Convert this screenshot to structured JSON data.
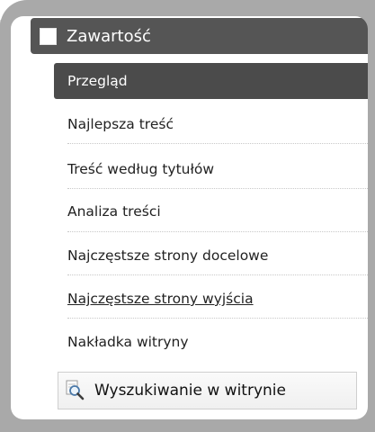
{
  "section": {
    "title": "Zawartość",
    "checkbox_icon": "checkbox-icon"
  },
  "menu": {
    "items": [
      {
        "label": "Przegląd",
        "active": true
      },
      {
        "label": "Najlepsza treść"
      },
      {
        "label": "Treść według tytułów"
      },
      {
        "label": "Analiza treści"
      },
      {
        "label": "Najczęstsze strony docelowe"
      },
      {
        "label": "Najczęstsze strony wyjścia",
        "underlined": true
      },
      {
        "label": "Nakładka witryny"
      }
    ]
  },
  "search": {
    "label": "Wyszukiwanie w witrynie",
    "icon": "magnifier-page-icon"
  },
  "colors": {
    "header_bg": "#555555",
    "active_bg": "#4b4b4b",
    "frame": "#a9a9a9"
  }
}
